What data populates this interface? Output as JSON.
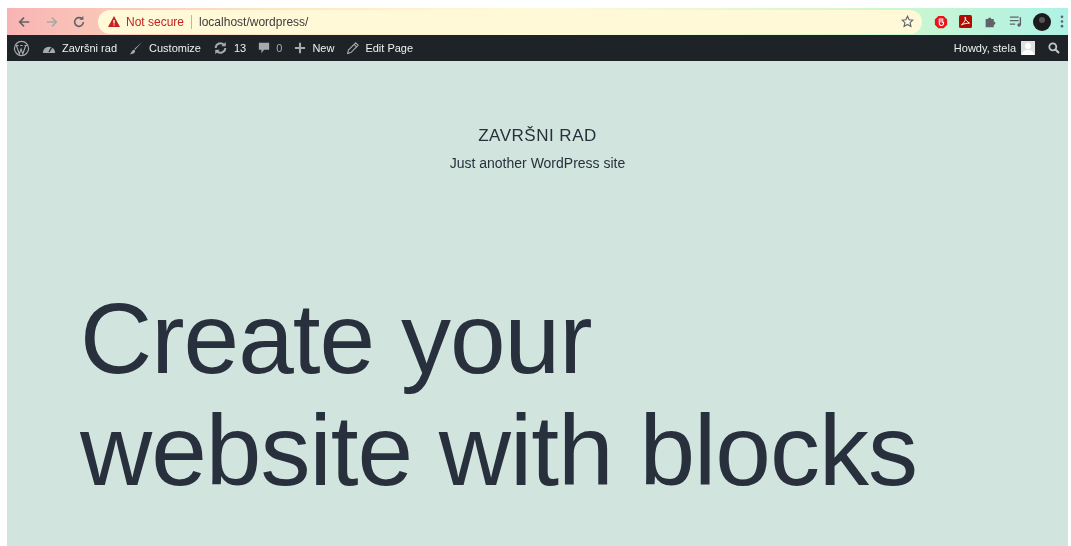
{
  "browser": {
    "security_label": "Not secure",
    "url": "localhost/wordpress/"
  },
  "admin_bar": {
    "items": [
      {
        "kind": "logo"
      },
      {
        "kind": "site",
        "label": "Završni rad"
      },
      {
        "kind": "customize",
        "label": "Customize"
      },
      {
        "kind": "updates",
        "label": "13"
      },
      {
        "kind": "comments",
        "label": "0"
      },
      {
        "kind": "new",
        "label": "New"
      },
      {
        "kind": "edit",
        "label": "Edit Page"
      }
    ],
    "greeting": "Howdy, stela"
  },
  "site": {
    "title": "ZAVRŠNI RAD",
    "tagline": "Just another WordPress site"
  },
  "hero": {
    "lines": [
      "Create your",
      "website with blocks"
    ]
  }
}
